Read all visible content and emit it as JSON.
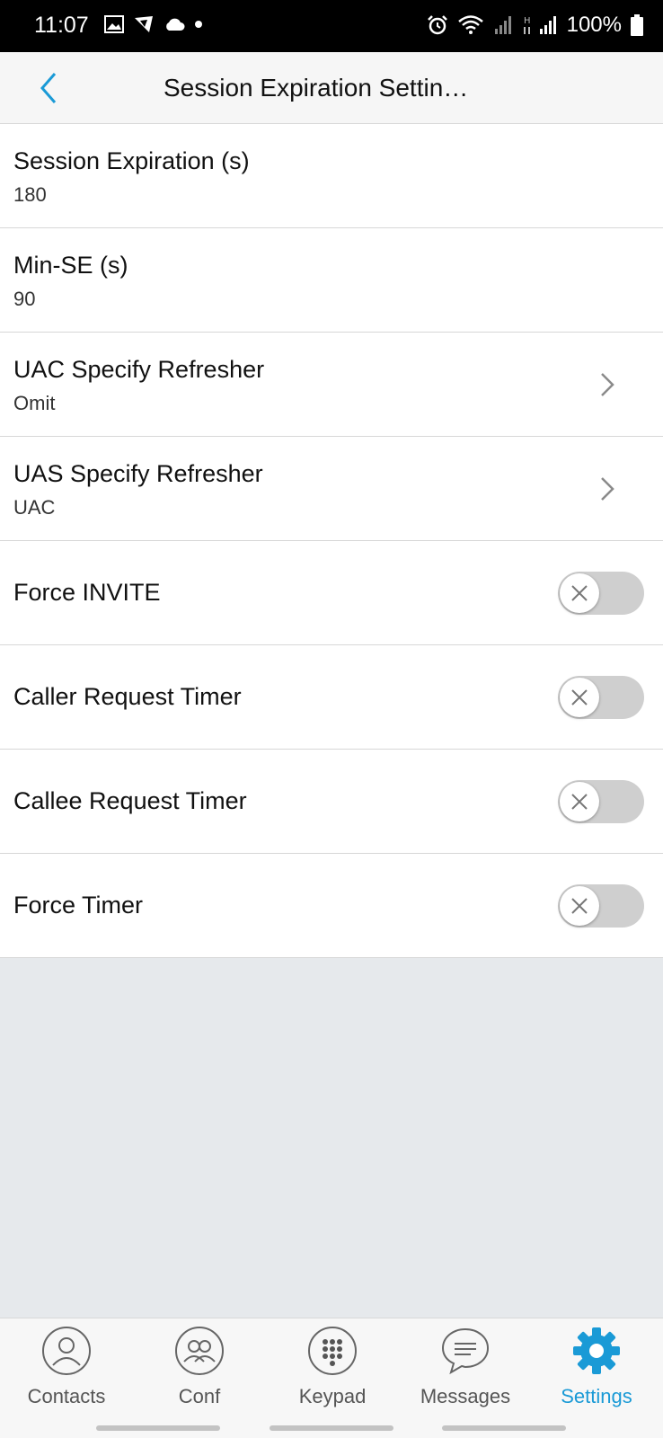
{
  "status_bar": {
    "time": "11:07",
    "battery": "100%",
    "left_icons": [
      "image-icon",
      "shield-app-icon",
      "cloud-icon",
      "dot-icon"
    ],
    "right_icons": [
      "alarm-icon",
      "wifi-icon",
      "signal-icon",
      "hspa-signal-icon",
      "battery-icon"
    ]
  },
  "header": {
    "title": "Session Expiration Settin…",
    "back_icon": "chevron-left-icon",
    "accent": "#1a9ad6"
  },
  "settings": [
    {
      "label": "Session Expiration (s)",
      "value": "180",
      "kind": "value"
    },
    {
      "label": "Min-SE (s)",
      "value": "90",
      "kind": "value"
    },
    {
      "label": "UAC Specify Refresher",
      "value": "Omit",
      "kind": "select"
    },
    {
      "label": "UAS Specify Refresher",
      "value": "UAC",
      "kind": "select"
    },
    {
      "label": "Force INVITE",
      "kind": "toggle",
      "enabled": false
    },
    {
      "label": "Caller Request Timer",
      "kind": "toggle",
      "enabled": false
    },
    {
      "label": "Callee Request Timer",
      "kind": "toggle",
      "enabled": false
    },
    {
      "label": "Force Timer",
      "kind": "toggle",
      "enabled": false
    }
  ],
  "tabs": [
    {
      "label": "Contacts",
      "icon": "contacts-icon",
      "active": false
    },
    {
      "label": "Conf",
      "icon": "conference-icon",
      "active": false
    },
    {
      "label": "Keypad",
      "icon": "keypad-icon",
      "active": false
    },
    {
      "label": "Messages",
      "icon": "messages-icon",
      "active": false
    },
    {
      "label": "Settings",
      "icon": "gear-icon",
      "active": true
    }
  ]
}
